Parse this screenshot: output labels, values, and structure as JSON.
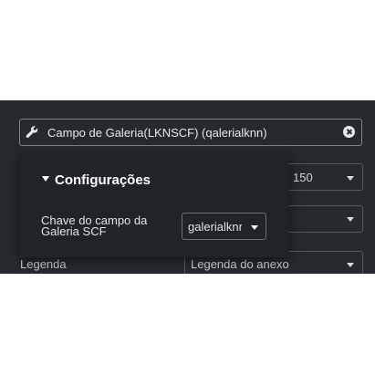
{
  "field": {
    "icon": "wrench-icon",
    "text": "Campo de Galeria(LKNSCF) (qalerialknn)",
    "clear_icon": "clear-circle-icon"
  },
  "background_controls": {
    "right_select_1_value": "150",
    "row_label": "Legenda",
    "row_select_value": "Legenda do anexo"
  },
  "popover": {
    "heading": "Configurações",
    "field_label": "Chave do campo da Galeria SCF",
    "select_value": "galerialknr"
  },
  "colors": {
    "panel_bg": "#26292d",
    "popover_bg": "#202327",
    "text": "#e6e8ea"
  }
}
